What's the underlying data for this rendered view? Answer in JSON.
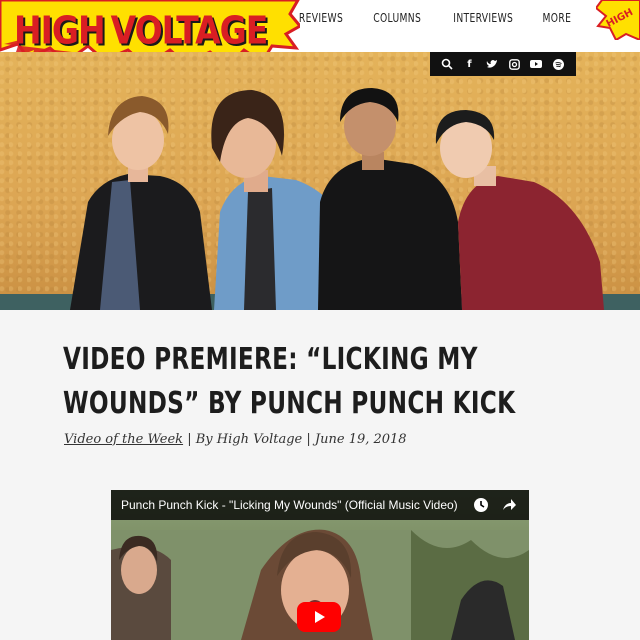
{
  "site": {
    "logo_high": "HIGH",
    "logo_voltage": "VOLTAGE",
    "badge_text": "HIGH"
  },
  "nav": {
    "items": [
      "REVIEWS",
      "COLUMNS",
      "INTERVIEWS",
      "MORE"
    ]
  },
  "social": {
    "icons": [
      "search-icon",
      "facebook-icon",
      "twitter-icon",
      "instagram-icon",
      "youtube-icon",
      "spotify-icon"
    ]
  },
  "article": {
    "title": "VIDEO PREMIERE: “LICKING MY WOUNDS” BY PUNCH PUNCH KICK",
    "category": "Video of the Week",
    "author": "By High Voltage",
    "date": "June 19, 2018"
  },
  "video": {
    "title": "Punch Punch Kick - \"Licking My Wounds\" (Official Music Video)"
  },
  "colors": {
    "brand_red": "#d91e23",
    "brand_yellow": "#ffe000",
    "youtube_red": "#ff0000"
  }
}
